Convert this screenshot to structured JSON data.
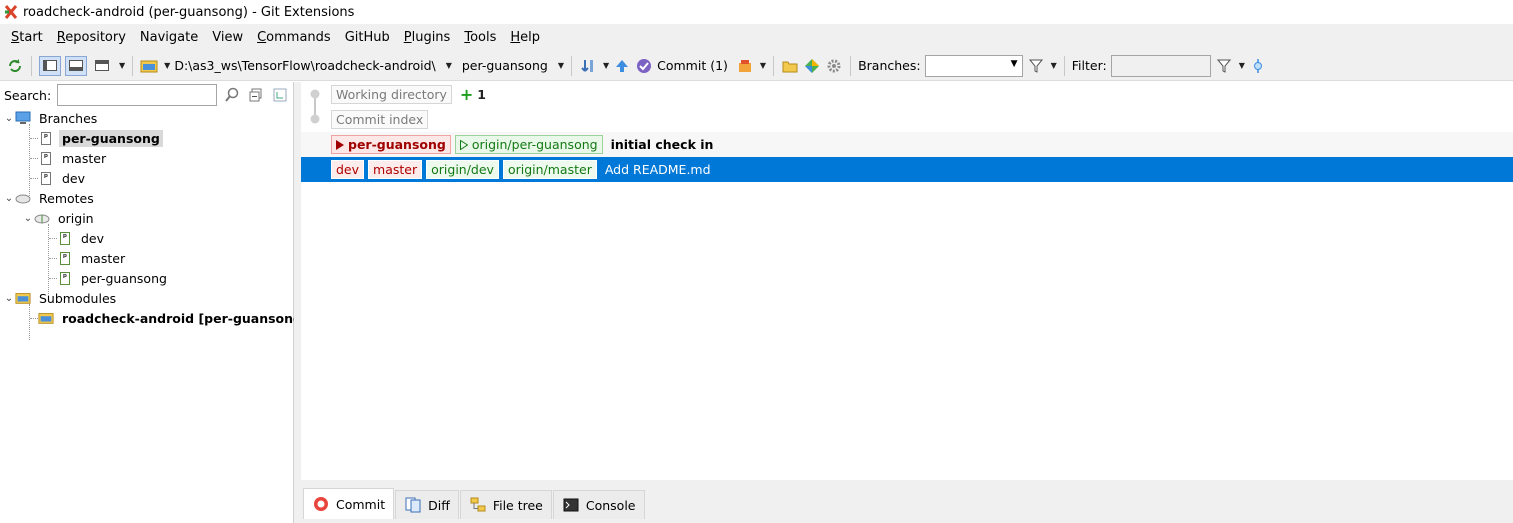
{
  "window": {
    "title": "roadcheck-android (per-guansong) - Git Extensions"
  },
  "menu": [
    {
      "label": "Start",
      "u": "S",
      "rest": "tart"
    },
    {
      "label": "Repository",
      "u": "R",
      "rest": "epository"
    },
    {
      "label": "Navigate",
      "u": "",
      "rest": "Navigate"
    },
    {
      "label": "View",
      "u": "",
      "rest": "View"
    },
    {
      "label": "Commands",
      "u": "C",
      "rest": "ommands"
    },
    {
      "label": "GitHub",
      "u": "",
      "rest": "GitHub"
    },
    {
      "label": "Plugins",
      "u": "P",
      "rest": "lugins"
    },
    {
      "label": "Tools",
      "u": "T",
      "rest": "ools"
    },
    {
      "label": "Help",
      "u": "H",
      "rest": "elp"
    }
  ],
  "toolbar": {
    "repo_path": "D:\\as3_ws\\TensorFlow\\roadcheck-android\\",
    "current_branch": "per-guansong",
    "commit_label": "Commit (1)",
    "branches_label": "Branches:",
    "filter_label": "Filter:",
    "branches_value": "",
    "filter_value": ""
  },
  "left": {
    "search_label": "Search:",
    "search_value": "",
    "branches_header": "Branches",
    "branches": [
      "per-guansong",
      "master",
      "dev"
    ],
    "remotes_header": "Remotes",
    "remote_name": "origin",
    "remote_branches": [
      "dev",
      "master",
      "per-guansong"
    ],
    "submodules_header": "Submodules",
    "submodule": "roadcheck-android [per-guansong]"
  },
  "grid": {
    "working_dir": "Working directory",
    "working_dir_count": "1",
    "commit_index": "Commit index",
    "commits": [
      {
        "refs_local": [
          "per-guansong"
        ],
        "refs_remote": [
          "origin/per-guansong"
        ],
        "message": "initial check in"
      },
      {
        "refs_local": [
          "dev",
          "master"
        ],
        "refs_remote": [
          "origin/dev",
          "origin/master"
        ],
        "message": "Add README.md"
      }
    ]
  },
  "tabs": [
    {
      "label": "Commit",
      "icon": "commit-icon"
    },
    {
      "label": "Diff",
      "icon": "diff-icon"
    },
    {
      "label": "File tree",
      "icon": "file-tree-icon"
    },
    {
      "label": "Console",
      "icon": "console-icon"
    }
  ],
  "colors": {
    "selection": "#0078d7",
    "local_ref": "#a00000",
    "remote_ref": "#137a13"
  }
}
